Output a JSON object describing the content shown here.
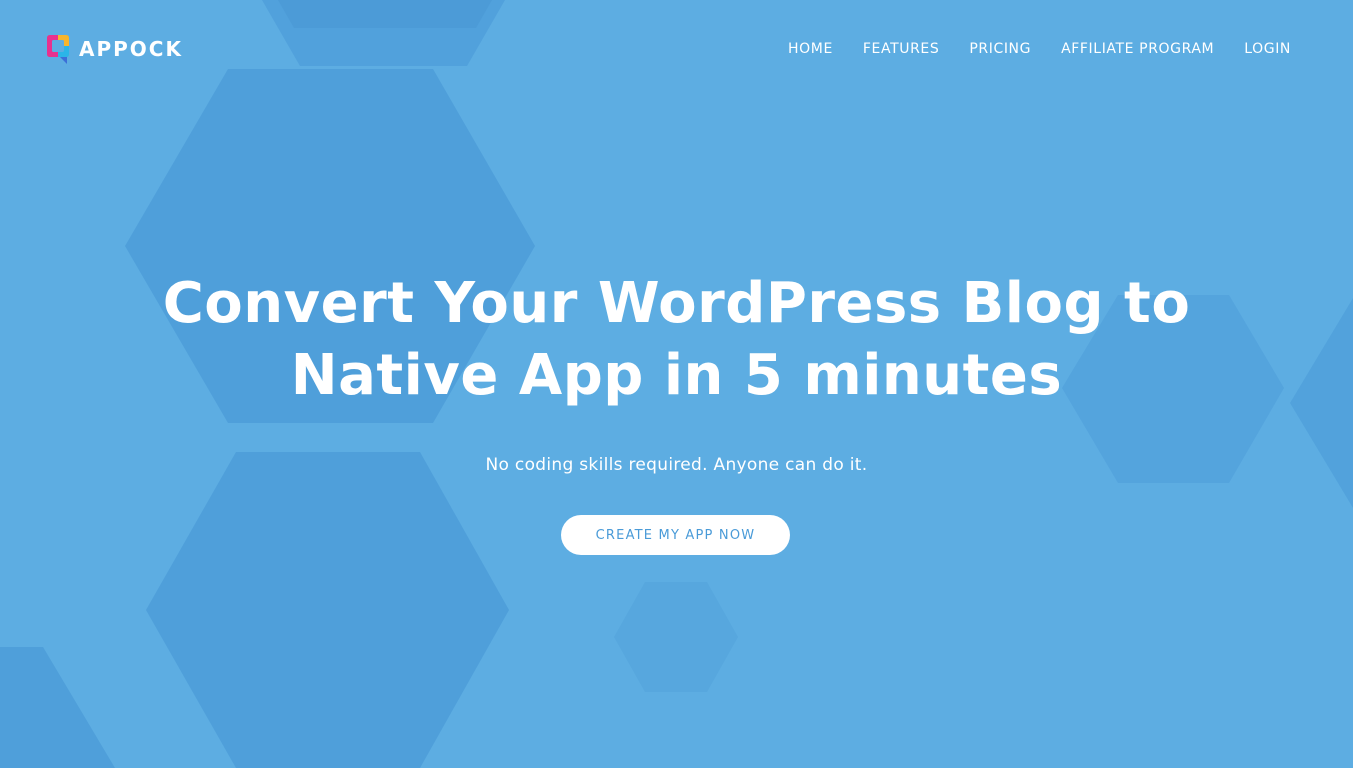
{
  "brand": {
    "name": "APPOCK",
    "logo_icon": "chat-bubble-logo-icon"
  },
  "nav": {
    "items": [
      {
        "label": "HOME"
      },
      {
        "label": "FEATURES"
      },
      {
        "label": "PRICING"
      },
      {
        "label": "AFFILIATE PROGRAM"
      },
      {
        "label": "LOGIN"
      }
    ]
  },
  "hero": {
    "headline_line1": "Convert Your WordPress Blog to",
    "headline_line2": "Native App in 5 minutes",
    "subtitle": "No coding skills required. Anyone can do it.",
    "cta_label": "CREATE MY APP NOW"
  },
  "colors": {
    "background": "#5dade2",
    "hexagon": "#4f9fda",
    "text": "#ffffff",
    "cta_text": "#4a9bd8"
  }
}
